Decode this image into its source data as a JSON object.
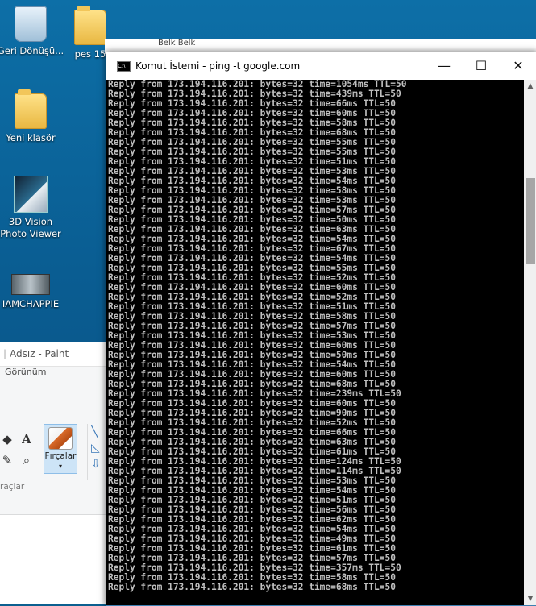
{
  "desktop": {
    "icons": [
      {
        "label": "Geri Dönüşü...",
        "icon": "recycle-bin-icon"
      },
      {
        "label": "pes 15",
        "icon": "folder-icon"
      },
      {
        "label": "Yeni klasör",
        "icon": "folder-icon"
      },
      {
        "label": "3D Vision Photo Viewer",
        "icon": "3d-vision-icon"
      },
      {
        "label": "IAMCHAPPIE",
        "icon": "video-thumbnail-icon"
      }
    ]
  },
  "behind_window": {
    "strip_text": "Belk   Belk"
  },
  "paint": {
    "title": "Adsız - Paint",
    "menu": "Görünüm",
    "brush_label": "Fırçalar",
    "tools_group_label": "raçlar"
  },
  "cmd": {
    "title": "Komut İstemi - ping  -t google.com",
    "controls": {
      "minimize": "—",
      "maximize": "☐",
      "close": "✕"
    },
    "prefix": "Reply from 173.194.116.201: bytes=32 time=",
    "ttl": "TTL=50",
    "times": [
      1054,
      439,
      66,
      60,
      58,
      68,
      55,
      55,
      51,
      53,
      54,
      58,
      53,
      57,
      50,
      63,
      54,
      67,
      54,
      55,
      52,
      60,
      52,
      51,
      58,
      57,
      53,
      60,
      50,
      54,
      60,
      68,
      239,
      60,
      90,
      52,
      66,
      63,
      61,
      124,
      114,
      53,
      54,
      51,
      56,
      62,
      54,
      49,
      61,
      57,
      357,
      58,
      68
    ]
  }
}
